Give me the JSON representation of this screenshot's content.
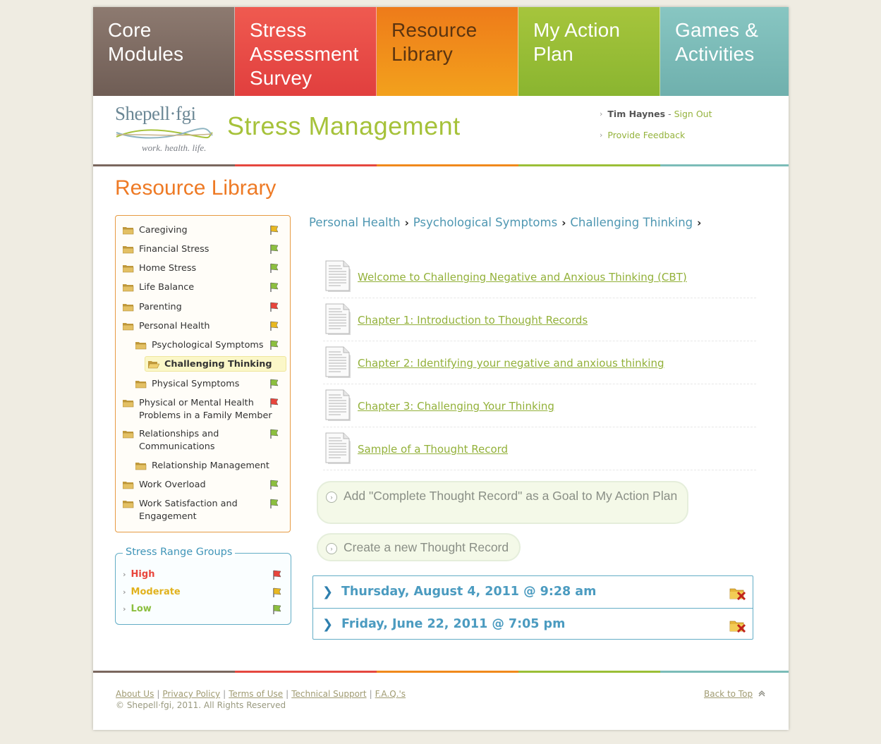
{
  "nav": {
    "tabs": [
      {
        "label": "Core Modules"
      },
      {
        "label": "Stress Assessment Survey"
      },
      {
        "label": "Resource Library"
      },
      {
        "label": "My Action Plan"
      },
      {
        "label": "Games & Activities"
      }
    ]
  },
  "header": {
    "logo_text": "Shepell·fgi",
    "logo_tagline": "work. health. life.",
    "app_title": "Stress Management",
    "user_name": "Tim Haynes",
    "separator": "-",
    "sign_out": "Sign Out",
    "feedback": "Provide Feedback"
  },
  "section_title": "Resource Library",
  "tree": {
    "items": [
      {
        "label": "Caregiving",
        "flag": "moderate"
      },
      {
        "label": "Financial Stress",
        "flag": "low"
      },
      {
        "label": "Home Stress",
        "flag": "low"
      },
      {
        "label": "Life Balance",
        "flag": "low"
      },
      {
        "label": "Parenting",
        "flag": "high"
      },
      {
        "label": "Personal Health",
        "flag": "moderate"
      },
      {
        "label": "Psychological Symptoms",
        "flag": "low"
      },
      {
        "label": "Challenging Thinking",
        "flag": ""
      },
      {
        "label": "Physical Symptoms",
        "flag": "low"
      },
      {
        "label": "Physical or Mental Health Problems in a Family Member",
        "flag": "high"
      },
      {
        "label": "Relationships and Communications",
        "flag": "low"
      },
      {
        "label": "Relationship Management",
        "flag": ""
      },
      {
        "label": "Work Overload",
        "flag": "low"
      },
      {
        "label": "Work Satisfaction and Engagement",
        "flag": "low"
      }
    ]
  },
  "legend": {
    "title": "Stress Range Groups",
    "items": [
      {
        "label": "High",
        "color": "#e8453c"
      },
      {
        "label": "Moderate",
        "color": "#e8b820"
      },
      {
        "label": "Low",
        "color": "#8cbf3f"
      }
    ]
  },
  "breadcrumb": [
    "Personal Health",
    "Psychological Symptoms",
    "Challenging Thinking"
  ],
  "breadcrumb_sep": "›",
  "documents": [
    "Welcome to Challenging Negative and Anxious Thinking (CBT)",
    "Chapter 1: Introduction to Thought Records",
    "Chapter 2: Identifying your negative and anxious thinking",
    "Chapter 3: Challenging Your Thinking",
    "Sample of a Thought Record"
  ],
  "actions": {
    "add_goal": "Add \"Complete Thought Record\" as a Goal to My Action Plan",
    "new_record": "Create a new Thought Record"
  },
  "records": [
    "Thursday, August 4, 2011 @ 9:28 am",
    "Friday, June 22, 2011 @ 7:05 pm"
  ],
  "footer": {
    "links": [
      "About Us",
      "Privacy Policy",
      "Terms of Use",
      "Technical Support",
      "F.A.Q.'s"
    ],
    "copyright": "© Shepell·fgi, 2011. All Rights Reserved",
    "back_to_top": "Back to Top"
  },
  "colors": {
    "brown": "#7a675e",
    "red": "#e5473f",
    "orange": "#f0891c",
    "green": "#9bbf37",
    "teal": "#7bbcb8"
  }
}
